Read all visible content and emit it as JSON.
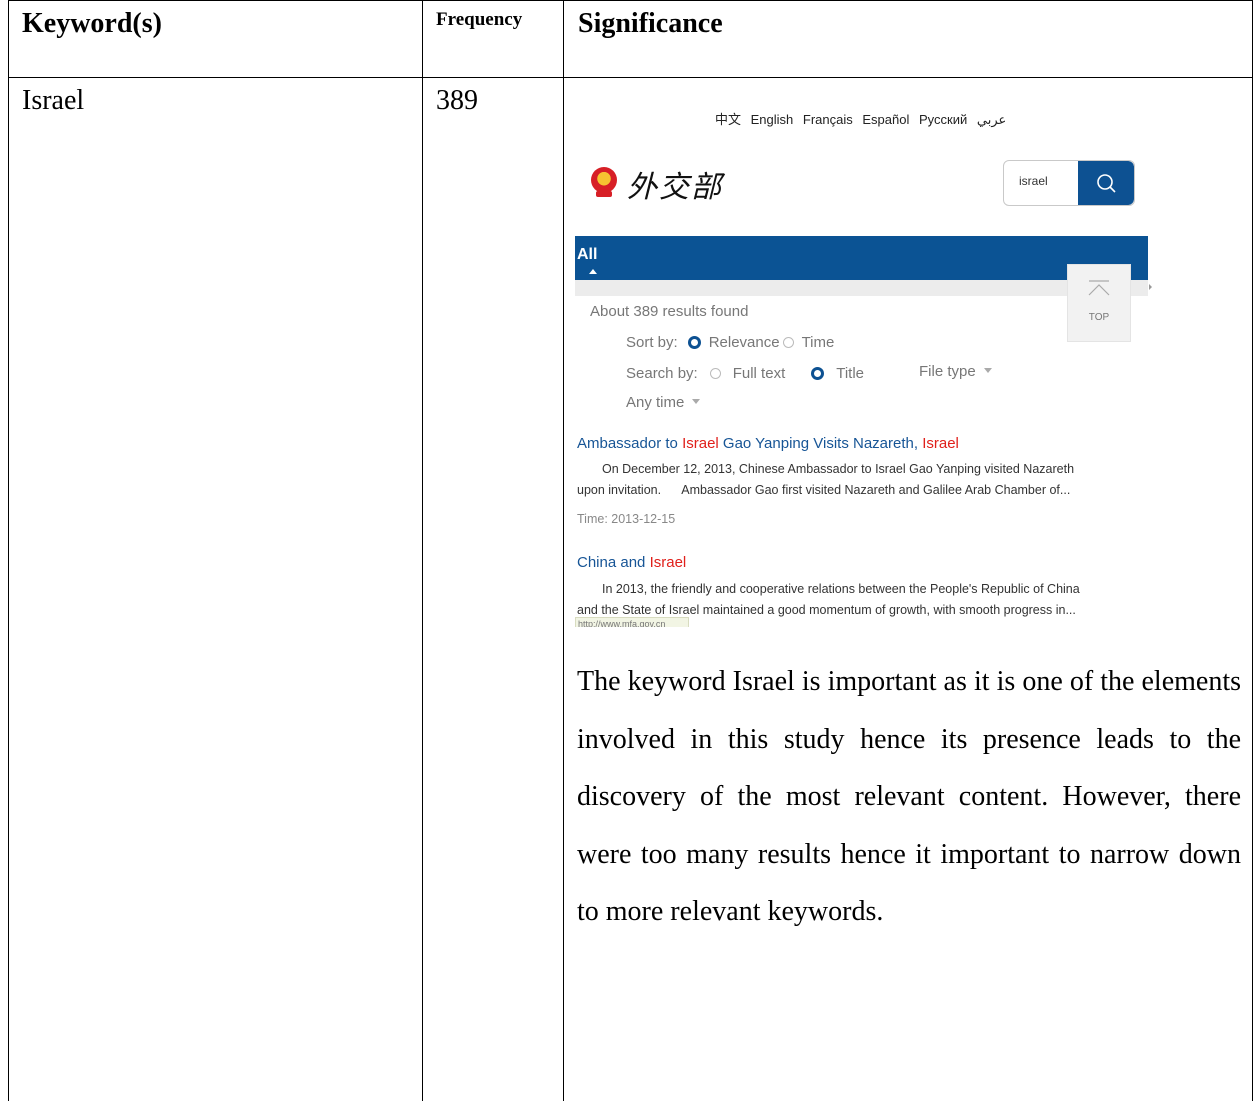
{
  "table": {
    "headers": {
      "keyword": "Keyword(s)",
      "frequency": "Frequency",
      "significance": "Significance"
    },
    "row": {
      "keyword": "Israel",
      "frequency": "389",
      "significance_text": "The keyword Israel is important as it is one of the elements involved in this study hence its presence leads to the discovery of the most relevant content. However, there were too many results hence it important to narrow down to more relevant keywords."
    }
  },
  "screenshot": {
    "languages": [
      "中文",
      "English",
      "Français",
      "Español",
      "Русский",
      "عربي"
    ],
    "logo_text": "外交部",
    "search_value": "israel",
    "tab_label": "All",
    "results_count": "About 389 results found",
    "sort_label": "Sort by:",
    "sort_relevance": "Relevance",
    "sort_time": "Time",
    "searchby_label": "Search by:",
    "searchby_full": "Full text",
    "searchby_title": "Title",
    "file_type": "File type",
    "any_time": "Any time",
    "top_label": "TOP",
    "results": [
      {
        "title_a": "Ambassador to ",
        "title_hl1": "Israel",
        "title_b": " Gao Yanping Visits Nazareth, ",
        "title_hl2": "Israel",
        "line1": "On December 12, 2013, Chinese Ambassador to Israel Gao Yanping visited Nazareth",
        "line2": "upon invitation.      Ambassador Gao first visited Nazareth and Galilee Arab Chamber of...",
        "time": "Time: 2013-12-15"
      },
      {
        "title_a": "China and ",
        "title_hl1": "Israel",
        "line1": "In 2013, the friendly and cooperative relations between the People's Republic of China",
        "line2": "and the State of Israel maintained a good momentum of growth, with smooth progress in..."
      }
    ],
    "url_tooltip": "http://www.mfa.gov.cn"
  }
}
